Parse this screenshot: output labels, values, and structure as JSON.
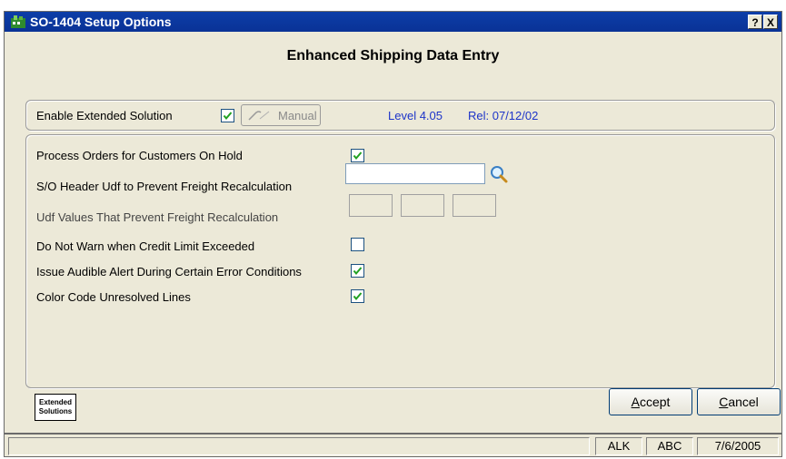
{
  "window": {
    "title": "SO-1404 Setup Options",
    "help_label": "?",
    "close_label": "X"
  },
  "heading": "Enhanced Shipping Data Entry",
  "top_panel": {
    "enable_label": "Enable Extended Solution",
    "enable_checked": true,
    "manual_label": "Manual",
    "level": "Level 4.05",
    "rel": "Rel: 07/12/02"
  },
  "options": {
    "process_orders_label": "Process Orders for Customers On Hold",
    "process_orders_checked": true,
    "udf_header_label": "S/O Header Udf to Prevent Freight Recalculation",
    "udf_header_value": "",
    "udf_values_label": "Udf Values That Prevent Freight Recalculation",
    "udf_values": [
      "",
      "",
      ""
    ],
    "no_warn_label": "Do Not Warn when Credit Limit Exceeded",
    "no_warn_checked": false,
    "audible_label": "Issue Audible Alert During Certain Error Conditions",
    "audible_checked": true,
    "color_code_label": "Color Code Unresolved Lines",
    "color_code_checked": true
  },
  "logo_text": [
    "Extended",
    "Solutions"
  ],
  "buttons": {
    "accept": "Accept",
    "cancel": "Cancel"
  },
  "status": {
    "cell1": "",
    "cell2": "ALK",
    "cell3": "ABC",
    "date": "7/6/2005"
  },
  "colors": {
    "title_bar": "#0a3296",
    "accent_text": "#1d34c9",
    "window_bg": "#ece9d8"
  }
}
